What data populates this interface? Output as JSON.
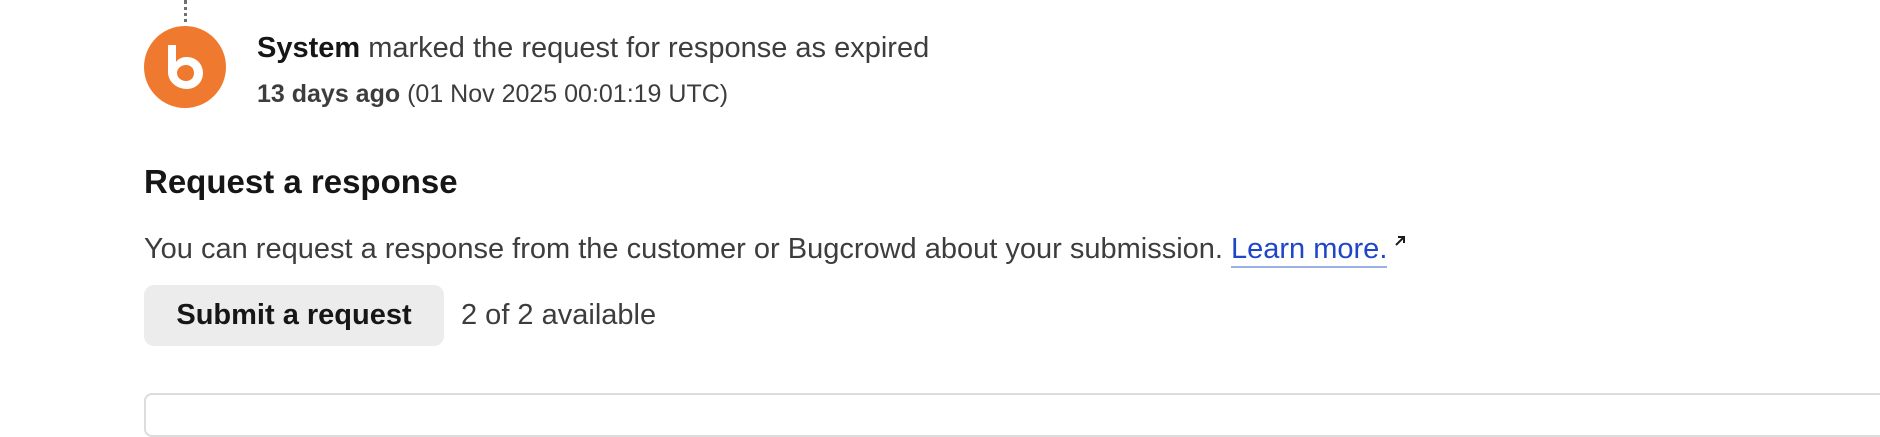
{
  "timeline_event": {
    "actor": "System",
    "action": "marked the request for response as expired",
    "time_relative": "13 days ago",
    "time_absolute": "(01 Nov 2025 00:01:19 UTC)",
    "avatar_icon": "bugcrowd-logo-icon",
    "avatar_color": "#ef7a2f"
  },
  "request_response": {
    "title": "Request a response",
    "description": "You can request a response from the customer or Bugcrowd about your submission.",
    "learn_more_label": "Learn more.",
    "learn_more_icon": "external-link-icon",
    "submit_label": "Submit a request",
    "availability": "2 of 2 available"
  },
  "colors": {
    "accent": "#ef7a2f",
    "link": "#1f46c8"
  }
}
